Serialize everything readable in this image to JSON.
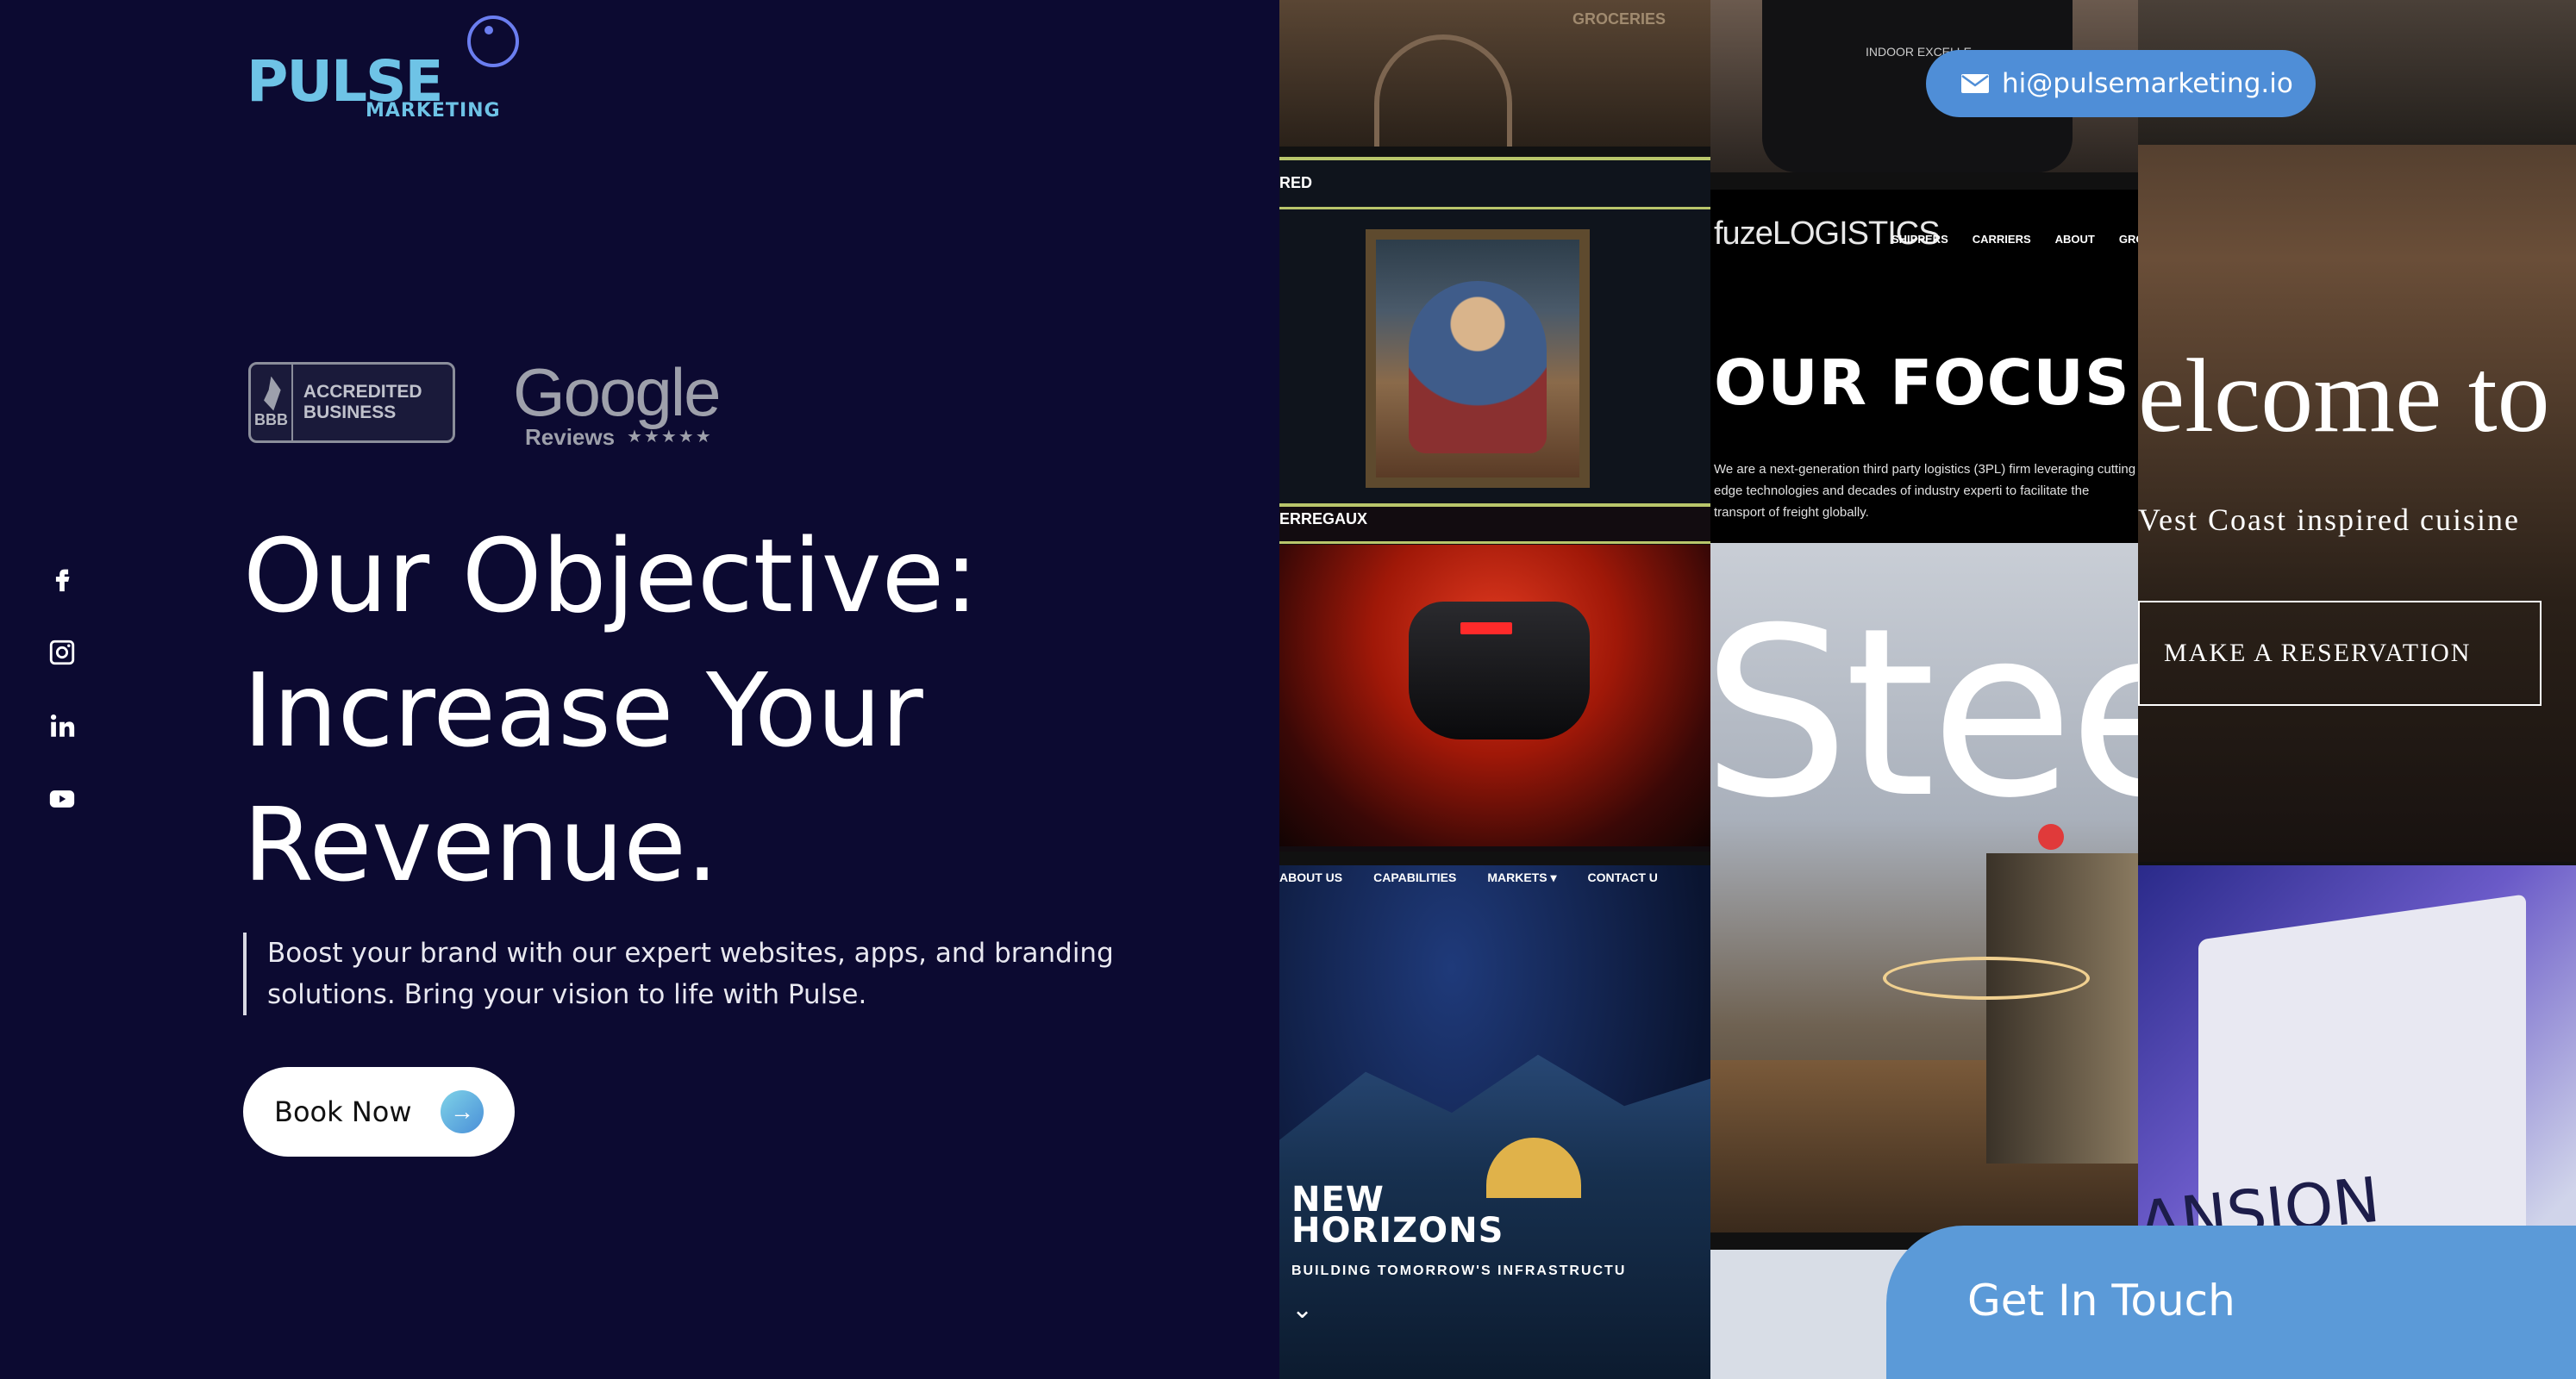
{
  "brand": {
    "logo_word": "PULSE",
    "logo_sub": "MARKETING"
  },
  "badges": {
    "bbb_seal": "BBB",
    "bbb_text": "ACCREDITED BUSINESS",
    "google_word": "Google",
    "google_reviews": "Reviews",
    "google_stars": "★★★★★"
  },
  "social": [
    {
      "name": "facebook-icon"
    },
    {
      "name": "instagram-icon"
    },
    {
      "name": "linkedin-icon"
    },
    {
      "name": "youtube-icon"
    }
  ],
  "hero": {
    "headline_1": "Our Objective:",
    "headline_2": "Increase Your",
    "headline_3": "Revenue.",
    "tagline": "Boost your brand with our expert websites, apps, and branding solutions. Bring your vision to life with Pulse.",
    "book_label": "Book Now"
  },
  "contact": {
    "email": "hi@pulsemarketing.io",
    "get_in_touch": "Get In Touch"
  },
  "collage": {
    "building_sign": "GROCERIES",
    "art_label": "RED",
    "watch_label": "ERREGAUX",
    "horizons_nav": [
      "ABOUT US",
      "CAPABILITIES",
      "MARKETS ▾",
      "CONTACT U"
    ],
    "horizons_title_1": "NEW",
    "horizons_title_2": "HORIZONS",
    "horizons_sub": "BUILDING TOMORROW'S INFRASTRUCTU",
    "horizons_chevron": "⌄",
    "portrait_badge": "INDOOR EXCELLE",
    "fuze_brand": "fuzeLOGISTICS",
    "fuze_menu": [
      "SHIPPERS",
      "CARRIERS",
      "ABOUT",
      "GROW OPPO"
    ],
    "fuze_focus": "OUR FOCUS",
    "fuze_desc": "We are a next-generation third party logistics (3PL) firm leveraging cutting edge technologies and decades of industry experti to facilitate the transport of freight globally.",
    "stee_word": "Stee",
    "rest_welcome": "elcome to",
    "rest_sub": "Vest Coast inspired cuisine",
    "rest_button": "MAKE A RESERVATION",
    "sign_word": "ANSION"
  },
  "colors": {
    "background": "#0c0a31",
    "accent": "#5b9ad8",
    "logo": "#6ec3e6"
  }
}
